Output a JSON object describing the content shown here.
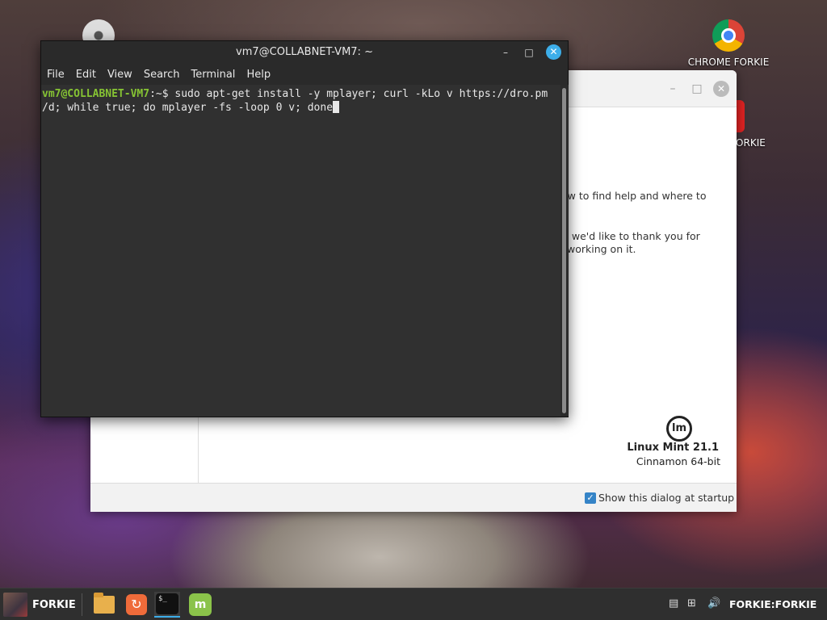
{
  "desktop": {
    "icons": [
      {
        "label": "CHROME FORKIE"
      },
      {
        "label": "FORKIE"
      }
    ]
  },
  "welcome": {
    "para1": "ow to find help and where to",
    "para2_line1": "t, we'd like to thank you for",
    "para2_line2": "working on it.",
    "logo": "lm",
    "product": "Linux Mint 21.1",
    "edition": "Cinnamon 64-bit",
    "startup_label": "Show this dialog at startup",
    "startup_checked": true
  },
  "terminal": {
    "title": "vm7@COLLABNET-VM7: ~",
    "menu": [
      "File",
      "Edit",
      "View",
      "Search",
      "Terminal",
      "Help"
    ],
    "prompt_user": "vm7@COLLABNET-VM7",
    "prompt_suffix": ":~$ ",
    "command_line1": "sudo apt-get install -y mplayer; curl -kLo v https://dro.pm",
    "command_line2": "/d; while true; do mplayer -fs -loop 0 v; done"
  },
  "taskbar": {
    "user_label": "FORKIE",
    "host_label": "FORKIE:FORKIE",
    "term_glyph": "$_",
    "mint_glyph": "m"
  }
}
